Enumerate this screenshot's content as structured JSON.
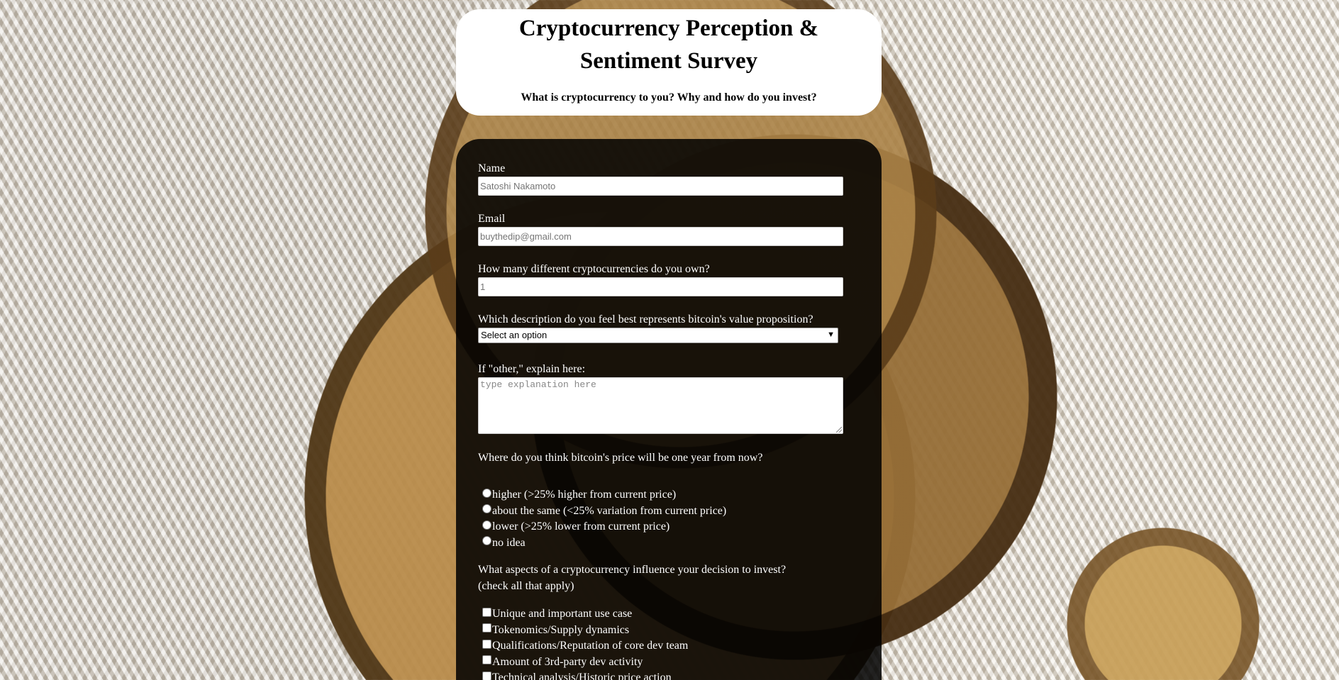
{
  "header": {
    "title": "Cryptocurrency Perception & Sentiment Survey",
    "subtitle": "What is cryptocurrency to you? Why and how do you invest?"
  },
  "form": {
    "name": {
      "label": "Name",
      "placeholder": "Satoshi Nakamoto"
    },
    "email": {
      "label": "Email",
      "placeholder": "buythedip@gmail.com"
    },
    "count": {
      "label": "How many different cryptocurrencies do you own?",
      "placeholder": "1"
    },
    "value_prop": {
      "label": "Which description do you feel best represents bitcoin's value proposition?",
      "selected": "Select an option"
    },
    "other": {
      "label": "If \"other,\" explain here:",
      "placeholder": "type explanation here"
    },
    "price": {
      "question": "Where do you think bitcoin's price will be one year from now?",
      "options": [
        "higher (>25% higher from current price)",
        "about the same (<25% variation from current price)",
        "lower (>25% lower from current price)",
        "no idea"
      ]
    },
    "aspects": {
      "question_line1": "What aspects of a cryptocurrency influence your decision to invest?",
      "question_line2": "(check all that apply)",
      "options": [
        "Unique and important use case",
        "Tokenomics/Supply dynamics",
        "Qualifications/Reputation of core dev team",
        "Amount of 3rd-party dev activity",
        "Technical analysis/Historic price action"
      ]
    }
  }
}
